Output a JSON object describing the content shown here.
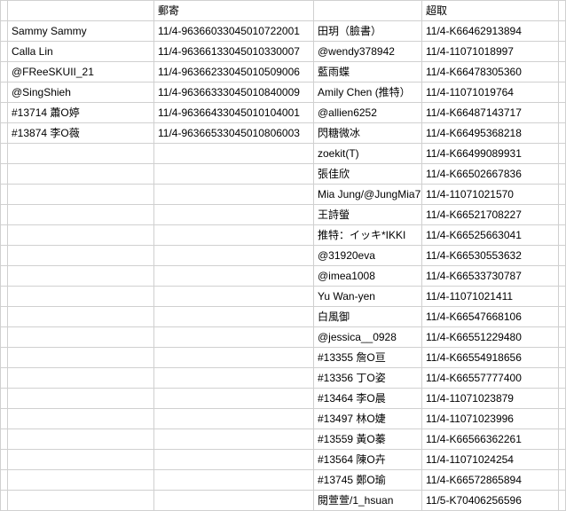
{
  "header": {
    "col2": "郵寄",
    "col4": "超取"
  },
  "left": [
    {
      "name": "Sammy Sammy",
      "code": "11/4-96366033045010722001"
    },
    {
      "name": "Calla Lin",
      "code": "11/4-96366133045010330007"
    },
    {
      "name": "@FReeSKUII_21",
      "code": "11/4-96366233045010509006"
    },
    {
      "name": "@SingShieh",
      "code": "11/4-96366333045010840009"
    },
    {
      "name": "#13714 蕭O婷",
      "code": "11/4-96366433045010104001"
    },
    {
      "name": "#13874 李O薇",
      "code": "11/4-96366533045010806003"
    }
  ],
  "right": [
    {
      "name": "田玥（臉書）",
      "code": "11/4-K66462913894"
    },
    {
      "name": "@wendy378942",
      "code": "11/4-11071018997"
    },
    {
      "name": "藍雨蝶",
      "code": "11/4-K66478305360"
    },
    {
      "name": "Amily Chen (推特）",
      "code": "11/4-11071019764"
    },
    {
      "name": "@allien6252",
      "code": "11/4-K66487143717"
    },
    {
      "name": "閃糖微冰",
      "code": "11/4-K66495368218"
    },
    {
      "name": "zoekit(T)",
      "code": "11/4-K66499089931"
    },
    {
      "name": "張佳欣",
      "code": "11/4-K66502667836"
    },
    {
      "name": "Mia Jung/@JungMia7",
      "code": "11/4-11071021570"
    },
    {
      "name": "王詩螢",
      "code": "11/4-K66521708227"
    },
    {
      "name": "推特：イッキ*IKKI",
      "code": "11/4-K66525663041"
    },
    {
      "name": "@31920eva",
      "code": "11/4-K66530553632"
    },
    {
      "name": "@imea1008",
      "code": "11/4-K66533730787"
    },
    {
      "name": "Yu Wan-yen",
      "code": "11/4-11071021411"
    },
    {
      "name": "白風御",
      "code": "11/4-K66547668106"
    },
    {
      "name": "@jessica__0928",
      "code": "11/4-K66551229480"
    },
    {
      "name": "#13355 詹O亘",
      "code": "11/4-K66554918656"
    },
    {
      "name": "#13356 丁O姿",
      "code": "11/4-K66557777400"
    },
    {
      "name": "#13464 李O晨",
      "code": "11/4-11071023879"
    },
    {
      "name": "#13497 林O婕",
      "code": "11/4-11071023996"
    },
    {
      "name": "#13559 黃O蓁",
      "code": "11/4-K66566362261"
    },
    {
      "name": "#13564 陳O卉",
      "code": "11/4-11071024254"
    },
    {
      "name": "#13745 鄭O瑜",
      "code": "11/4-K66572865894"
    },
    {
      "name": "閱萱萱/1_hsuan",
      "code": "11/5-K70406256596"
    }
  ]
}
